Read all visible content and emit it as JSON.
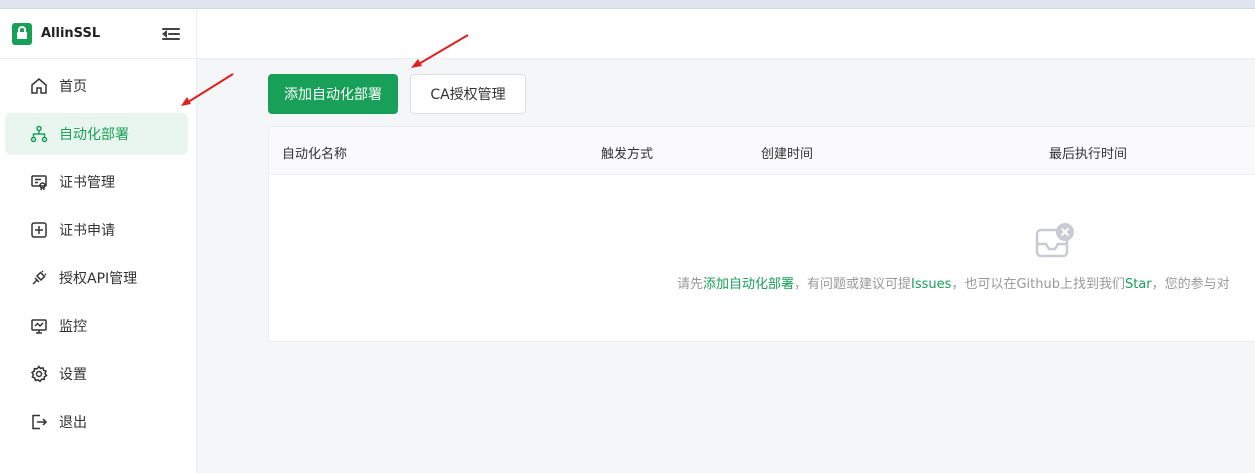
{
  "brand": {
    "name": "AllinSSL",
    "logo_text": "ALLINSSL"
  },
  "sidebar": {
    "items": [
      {
        "label": "首页",
        "icon": "home-icon",
        "active": false
      },
      {
        "label": "自动化部署",
        "icon": "workflow-icon",
        "active": true
      },
      {
        "label": "证书管理",
        "icon": "certificate-icon",
        "active": false
      },
      {
        "label": "证书申请",
        "icon": "plus-square-icon",
        "active": false
      },
      {
        "label": "授权API管理",
        "icon": "api-plug-icon",
        "active": false
      },
      {
        "label": "监控",
        "icon": "monitor-icon",
        "active": false
      },
      {
        "label": "设置",
        "icon": "gear-icon",
        "active": false
      },
      {
        "label": "退出",
        "icon": "logout-icon",
        "active": false
      }
    ]
  },
  "toolbar": {
    "add_label": "添加自动化部署",
    "ca_label": "CA授权管理"
  },
  "table": {
    "columns": [
      "自动化名称",
      "触发方式",
      "创建时间",
      "最后执行时间"
    ]
  },
  "empty": {
    "t1": "请先",
    "l1": "添加自动化部署",
    "t2": "，有问题或建议可提",
    "l2": "Issues",
    "t3": "，也可以在Github上找到我们",
    "l3": "Star",
    "t4": "，您的参与对"
  },
  "colors": {
    "primary": "#18a058",
    "active_bg": "#e9f6ef",
    "arrow": "#e02020"
  }
}
